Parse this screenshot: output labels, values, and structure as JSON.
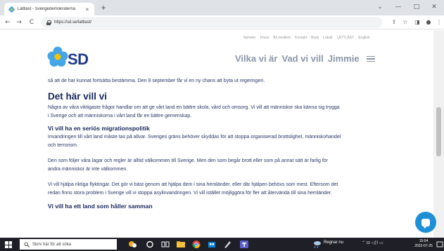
{
  "browser": {
    "tab_title": "Lättläst - Sverigedemokraterna",
    "tab_close": "×",
    "new_tab": "+",
    "url": "https://sd.se/lattlast/",
    "window_controls": {
      "collapse": "⌄",
      "minimize": "—",
      "maximize": "□",
      "close": "✕"
    },
    "nav": {
      "back": "←",
      "forward": "→",
      "reload": "C"
    },
    "toolbar": {
      "share": "⇪",
      "star": "☆",
      "sidebar": "◨",
      "profile": "●",
      "menu": "⋮"
    }
  },
  "site": {
    "top_nav": [
      "Nyheter",
      "Press",
      "Bli medlem",
      "Kontakt",
      "Butik",
      "Lokalt",
      "LÄTTLÄST",
      "English"
    ],
    "logo_text": "SD",
    "main_nav": [
      "Vilka vi är",
      "Vad vi vill",
      "Jimmie"
    ],
    "brand_colors": {
      "blue": "#1d3a8a",
      "yellow": "#f5c400",
      "light_blue": "#45a5e6"
    }
  },
  "content": {
    "intro": "så att de har kunnat fortsätta bestämma. Den 9 september får vi en ny chans att byta ut regeringen.",
    "heading": "Det här vill vi",
    "heading_text_1": "Några av våra viktigaste frågor handlar om att ge vårt land en bättre skola, vård och omsorg. Vi  vill att människor ska känna sig trygga",
    "heading_text_2": "i Sverige och att människorna i vårt land får en bättre gemenskap.",
    "section1_title": "Vi vill ha en seriös migrationspolitik",
    "s1_p1_l1": "Invandringen till vårt land måste tas på allvar. Sveriges gräns behöver skyddas för att stoppa organiserad brottslighet, människohandel",
    "s1_p1_l2": "och terrorism.",
    "s1_p2_l1": "Den som följer våra lagar och regler är alltid välkommen till Sverige. Men den som begår brott eller som på annat sätt är farlig för",
    "s1_p2_l2": "andra människor är inte välkommen.",
    "s1_p3_l1": "Vi vill hjälpa riktiga flyktingar. Det gör vi bäst genom att hjälpa dem i sina hemländer, eller där hjälpen behövs som mest. Eftersom det",
    "s1_p3_l2": "redan finns stora problem i Sverige vill vi stoppa asylinvandringen. Vi vill istället möjliggöra för fler att återvända till sina hemländer.",
    "section2_title": "Vi vill ha ett land som håller samman"
  },
  "taskbar": {
    "search_placeholder": "Skriv här för att söka",
    "weather": "Regnar nu",
    "tray": "⌃  ⊟  ◁))  ▭",
    "time": "15:04",
    "date": "2022-07-25"
  }
}
